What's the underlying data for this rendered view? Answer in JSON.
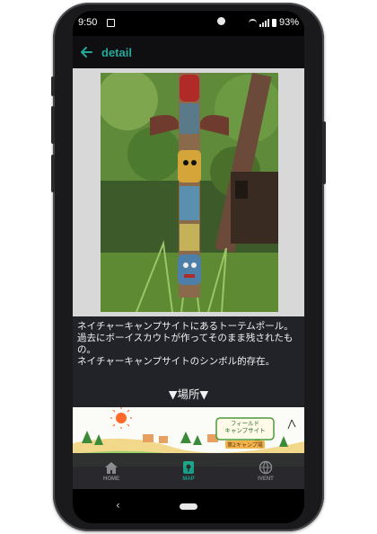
{
  "status_bar": {
    "time": "9:50",
    "battery": "93%"
  },
  "app_bar": {
    "title": "detail",
    "accent_color": "#22a99a"
  },
  "photo": {
    "subject": "totem-pole-photo"
  },
  "description": {
    "text": "ネイチャーキャンプサイトにあるトーテムポール。\n過去にボーイスカウトが作ってそのまま残されたもの。\nネイチャーキャンプサイトのシンボル的存在。"
  },
  "location_heading": "▼場所▼",
  "map": {
    "sign_line1": "フィールド",
    "sign_line2": "キャンプサイト",
    "sign_line3": "第2キャンプ場"
  },
  "bottom_nav": {
    "items": [
      {
        "label": "HOME",
        "icon": "home-icon"
      },
      {
        "label": "MAP",
        "icon": "map-icon"
      },
      {
        "label": "IVENT",
        "icon": "globe-icon"
      }
    ],
    "active_color": "#1aa48c",
    "inactive_color": "#8d8d94"
  }
}
